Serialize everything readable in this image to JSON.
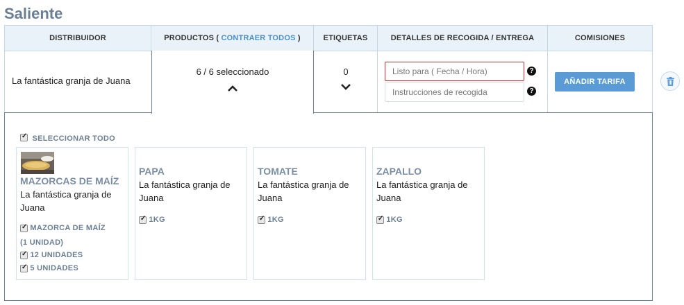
{
  "title": "Saliente",
  "headers": {
    "distribuidor": "DISTRIBUIDOR",
    "productos": "PRODUCTOS (",
    "contraer": "CONTRAER TODOS",
    "productos_close": ")",
    "etiquetas": "ETIQUETAS",
    "detalles": "DETALLES DE RECOGIDA / ENTREGA",
    "comisiones": "COMISIONES"
  },
  "row": {
    "distributor": "La fantástica granja de Juana",
    "selected": "6 / 6 seleccionado",
    "tags_count": "0",
    "ready_placeholder": "Listo para ( Fecha / Hora)",
    "instructions_placeholder": "Instrucciones de recogida",
    "add_rate": "AÑADIR TARIFA"
  },
  "select_all": "SELECCIONAR TODO",
  "products": [
    {
      "name": "MAZORCAS DE MAÍZ",
      "farm": "La fantástica granja de Juana",
      "options": [
        "MAZORCA DE MAÍZ",
        "(1 UNIDAD)",
        "12 UNIDADES",
        "5 UNIDADES"
      ]
    },
    {
      "name": "PAPA",
      "farm": "La fantástica granja de Juana",
      "options": [
        "1KG"
      ]
    },
    {
      "name": "TOMATE",
      "farm": "La fantástica granja de Juana",
      "options": [
        "1KG"
      ]
    },
    {
      "name": "ZAPALLO",
      "farm": "La fantástica granja de Juana",
      "options": [
        "1KG"
      ]
    }
  ],
  "colors": {
    "accent": "#4a90c9",
    "button": "#5b9bd5",
    "error_border": "#c9302c",
    "header_bg": "#eaf2f9"
  },
  "icons": [
    "chevron-up-icon",
    "chevron-down-icon",
    "help-icon",
    "trash-icon",
    "checkbox-icon"
  ]
}
